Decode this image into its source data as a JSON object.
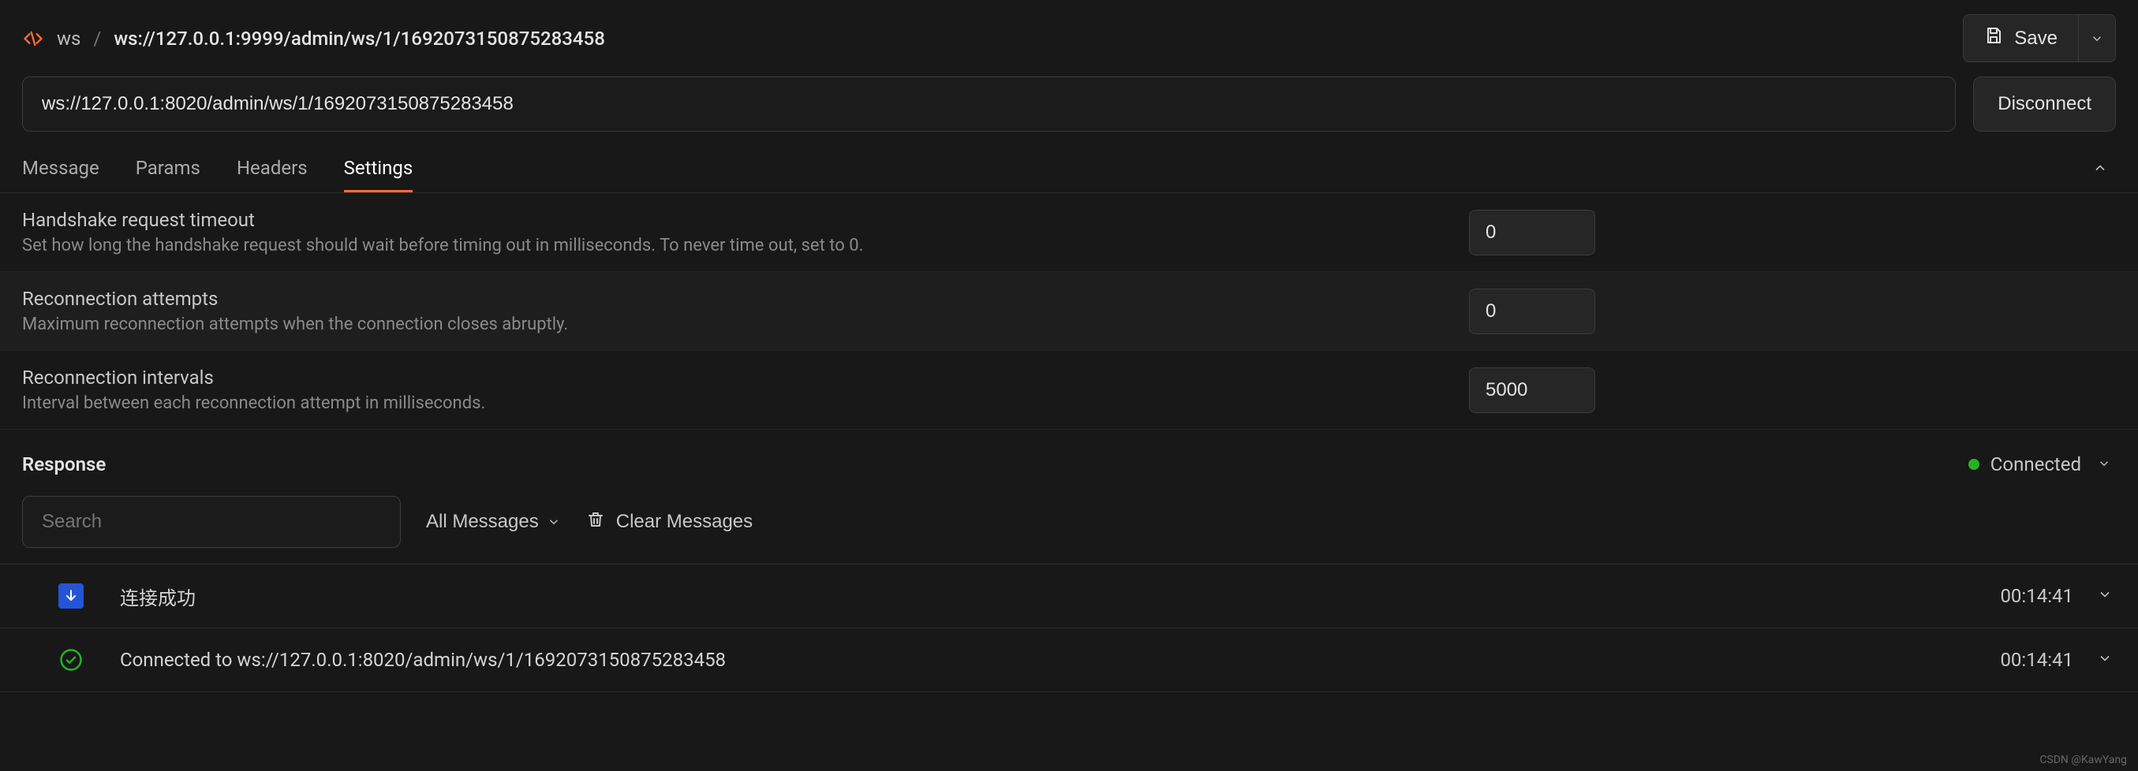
{
  "breadcrumb": {
    "name": "ws",
    "url": "ws://127.0.0.1:9999/admin/ws/1/1692073150875283458"
  },
  "save": {
    "label": "Save"
  },
  "url_input": {
    "value": "ws://127.0.0.1:8020/admin/ws/1/1692073150875283458"
  },
  "disconnect": {
    "label": "Disconnect"
  },
  "tabs": [
    {
      "label": "Message"
    },
    {
      "label": "Params"
    },
    {
      "label": "Headers"
    },
    {
      "label": "Settings"
    }
  ],
  "settings": [
    {
      "title": "Handshake request timeout",
      "desc": "Set how long the handshake request should wait before timing out in milliseconds. To never time out, set to 0.",
      "value": "0"
    },
    {
      "title": "Reconnection attempts",
      "desc": "Maximum reconnection attempts when the connection closes abruptly.",
      "value": "0"
    },
    {
      "title": "Reconnection intervals",
      "desc": "Interval between each reconnection attempt in milliseconds.",
      "value": "5000"
    }
  ],
  "response": {
    "title": "Response",
    "status": "Connected",
    "search_placeholder": "Search",
    "filter_label": "All Messages",
    "clear_label": "Clear Messages"
  },
  "messages": [
    {
      "type": "incoming",
      "text": "连接成功",
      "time": "00:14:41"
    },
    {
      "type": "connected",
      "text": "Connected to ws://127.0.0.1:8020/admin/ws/1/1692073150875283458",
      "time": "00:14:41"
    }
  ],
  "watermark": "CSDN @KawYang"
}
